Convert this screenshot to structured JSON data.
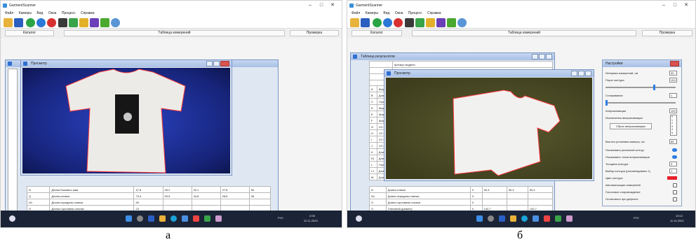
{
  "app": {
    "title": "GarmentScanner",
    "menu": [
      "Файл",
      "Камеры",
      "Вид",
      "Окна",
      "Процесс",
      "Справка"
    ],
    "buttons": {
      "catalog": "Каталог",
      "measurement_table": "Таблица измерений",
      "check": "Проверка"
    }
  },
  "panel_a": {
    "viewer_title": "Просмотр",
    "rows": [
      {
        "code": "N",
        "name": "Длина бокового шва",
        "values": [
          "47,8",
          "28,2",
          "20,1",
          "27,8",
          "56"
        ]
      },
      {
        "code": "Q",
        "name": "Длина спинки",
        "values": [
          "73,4",
          "59,5",
          "44,8",
          "28,8",
          "36"
        ]
      },
      {
        "code": "N1",
        "name": "Длина середины спинки",
        "values": [
          "59",
          "",
          "",
          "",
          ""
        ]
      },
      {
        "code": "G",
        "name": "Длина горловины спинки",
        "values": [
          "23",
          "",
          "",
          "",
          ""
        ]
      },
      {
        "code": "O",
        "name": "Плечевой диаметр",
        "values": [
          "46,5",
          "31,6",
          "",
          "5,1",
          "11"
        ]
      }
    ],
    "clock_time": "2:05",
    "clock_date": "22.11.2023",
    "tray_lang": "РУС"
  },
  "panel_b": {
    "results_title": "Таблица результатов",
    "viewer_title": "Просмотр",
    "top_rows": [
      {
        "code": "",
        "name": "Артикул модели"
      },
      {
        "code": "",
        "name": "Цвет"
      },
      {
        "code": "",
        "name": "Разме"
      },
      {
        "code": "",
        "name": "Назва"
      }
    ],
    "left_codes": [
      "A",
      "B",
      "C",
      "D",
      "E",
      "F",
      "G",
      "H",
      "I",
      "J",
      "K",
      "K1",
      "L",
      "L1",
      "M"
    ],
    "left_names": [
      "Шири",
      "Длина",
      "Глуби",
      "Шири",
      "Шири",
      "Шири",
      "1/2 Ш",
      "1/2 Ш",
      "1/2 Ш",
      "1/2 Ш",
      "Длина",
      "Длина",
      "Глуби",
      "Длина",
      "Длина"
    ],
    "rows": [
      {
        "code": "N",
        "name": "Длина спинки",
        "values": [
          "0",
          "50,4",
          "50,4",
          "50,4"
        ]
      },
      {
        "code": "N1",
        "name": "Длина середины спинки",
        "values": [
          "0",
          "",
          "",
          ""
        ]
      },
      {
        "code": "G",
        "name": "Длина горловины спинки",
        "values": [
          "0",
          "",
          "",
          ""
        ]
      },
      {
        "code": "O",
        "name": "Плечевой диаметр",
        "values": [
          "0",
          "140,7",
          "",
          "140,7"
        ]
      }
    ],
    "settings": {
      "title": "Настройки",
      "interval_label": "Интервал измерений, см",
      "interval_value": "30",
      "threshold_label": "Порог контура",
      "threshold_value": "153",
      "smoothing_label": "Сглаживание",
      "smoothing_value": "1",
      "approx_label": "Аппроксимация",
      "approx_value": "100",
      "exclusions_label": "Исключения аппроксимации",
      "exclusions_list": [
        "0",
        "1",
        "2",
        "3",
        "4",
        "5"
      ],
      "reset_button": "Сброс аппроксимации",
      "camera_height_label": "Высота установки камеры, см",
      "camera_height_value": "85",
      "show_real_contour": "Показывать реальный контур",
      "show_approx_points": "Показывать точки аппроксимации",
      "contour_thickness_label": "Толщина контура",
      "contour_thickness_value": "3",
      "contour_choice_label": "Выбор контура (рекомендовано 1)",
      "contour_choice_value": "1",
      "contour_color_label": "Цвет контура",
      "contour_color": "#e8202a",
      "auto_measure": "Автоматизация измерений",
      "voice": "Голосовое сопровождение",
      "stop_on_defect": "Остановить при дефекте"
    },
    "clock_time": "19:12",
    "clock_date": "11.11.2023",
    "tray_lang": "РУС"
  },
  "captions": {
    "a": "а",
    "b": "б"
  },
  "colors": {
    "viewer_blue": "#1e2f9c",
    "viewer_olive": "#4a4a26",
    "accent": "#2f7de1",
    "taskbar": "#1b2436"
  },
  "icons": {
    "toolbar": [
      "folder-open-icon",
      "save-icon",
      "play-icon",
      "pause-icon",
      "stop-icon",
      "camera-icon",
      "chart-icon",
      "brush-icon",
      "capture-icon",
      "gear-icon",
      "globe-icon"
    ],
    "taskbar": [
      "windows-icon",
      "search-icon",
      "task-view-icon",
      "explorer-icon",
      "edge-icon",
      "store-icon",
      "app-icon",
      "app-icon",
      "app-icon"
    ]
  }
}
